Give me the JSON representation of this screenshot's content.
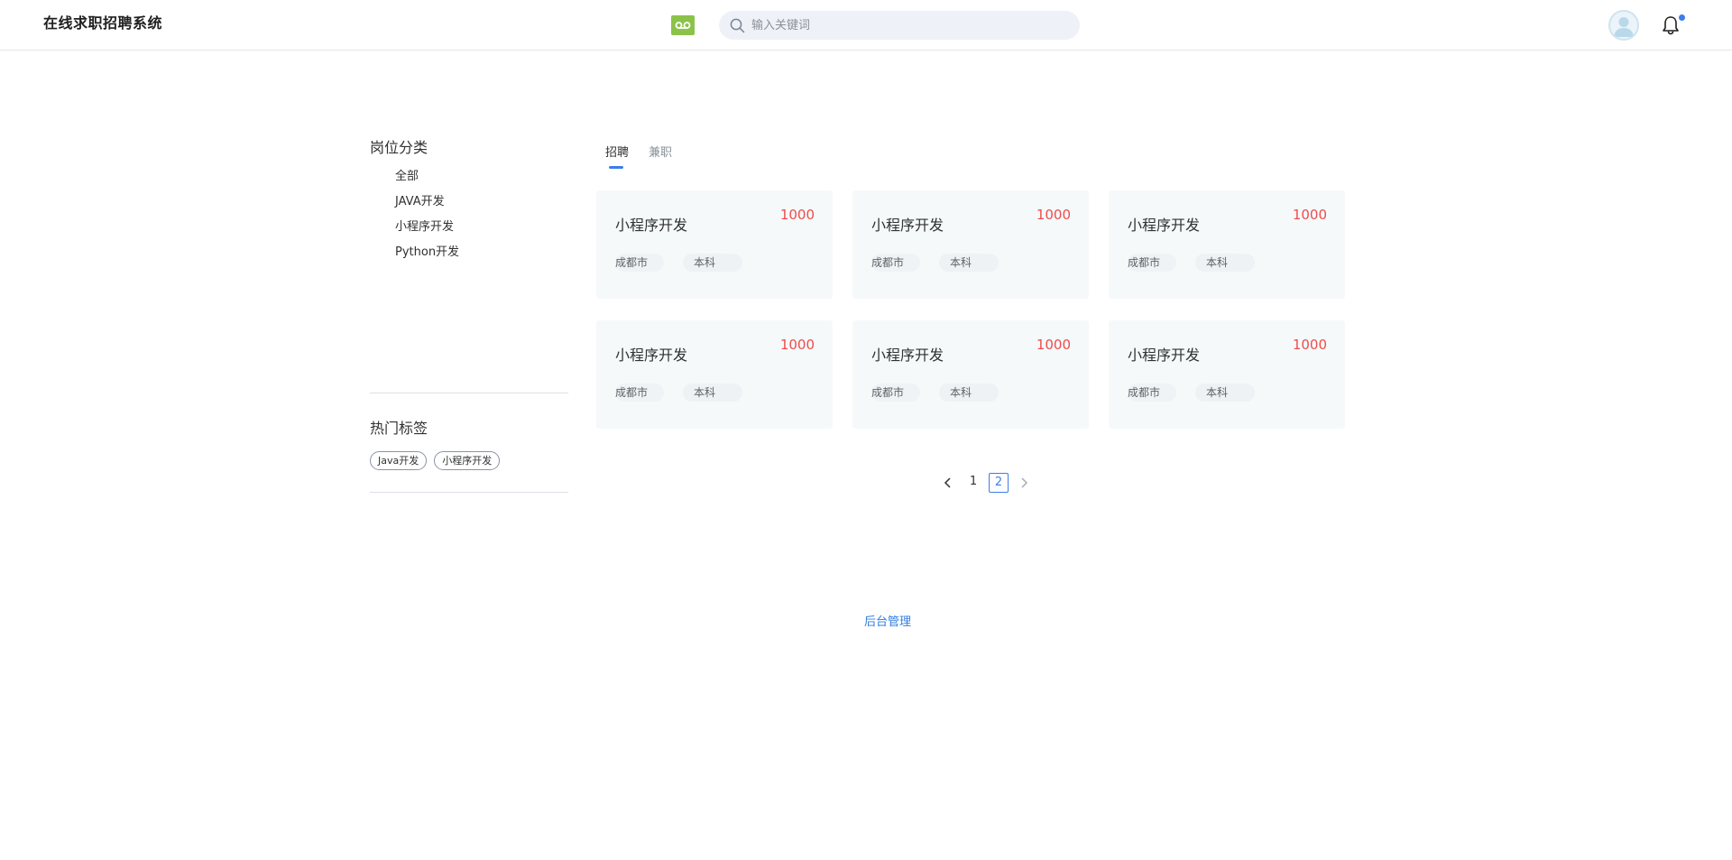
{
  "header": {
    "app_title": "在线求职招聘系统",
    "search_placeholder": "输入关键词"
  },
  "sidebar": {
    "category_heading": "岗位分类",
    "categories": [
      "全部",
      "JAVA开发",
      "小程序开发",
      "Python开发"
    ],
    "hot_heading": "热门标签",
    "tags": [
      "Java开发",
      "小程序开发"
    ]
  },
  "tabs": [
    {
      "label": "招聘",
      "active": true
    },
    {
      "label": "兼职",
      "active": false
    }
  ],
  "jobs": [
    {
      "title": "小程序开发",
      "salary": "1000",
      "city": "成都市",
      "education": "本科"
    },
    {
      "title": "小程序开发",
      "salary": "1000",
      "city": "成都市",
      "education": "本科"
    },
    {
      "title": "小程序开发",
      "salary": "1000",
      "city": "成都市",
      "education": "本科"
    },
    {
      "title": "小程序开发",
      "salary": "1000",
      "city": "成都市",
      "education": "本科"
    },
    {
      "title": "小程序开发",
      "salary": "1000",
      "city": "成都市",
      "education": "本科"
    },
    {
      "title": "小程序开发",
      "salary": "1000",
      "city": "成都市",
      "education": "本科"
    }
  ],
  "pagination": {
    "pages": [
      "1",
      "2"
    ],
    "current": "2"
  },
  "footer": {
    "admin_link": "后台管理"
  },
  "colors": {
    "accent": "#3b7ded",
    "salary": "#f04c4c",
    "voicemail_bg": "#8bc34a",
    "card_bg": "#f5f9fa"
  },
  "icons": {
    "voicemail": "voicemail-icon",
    "search": "search-icon",
    "avatar": "user-avatar-icon",
    "bell": "bell-icon",
    "prev": "chevron-left-icon",
    "next": "chevron-right-icon"
  }
}
